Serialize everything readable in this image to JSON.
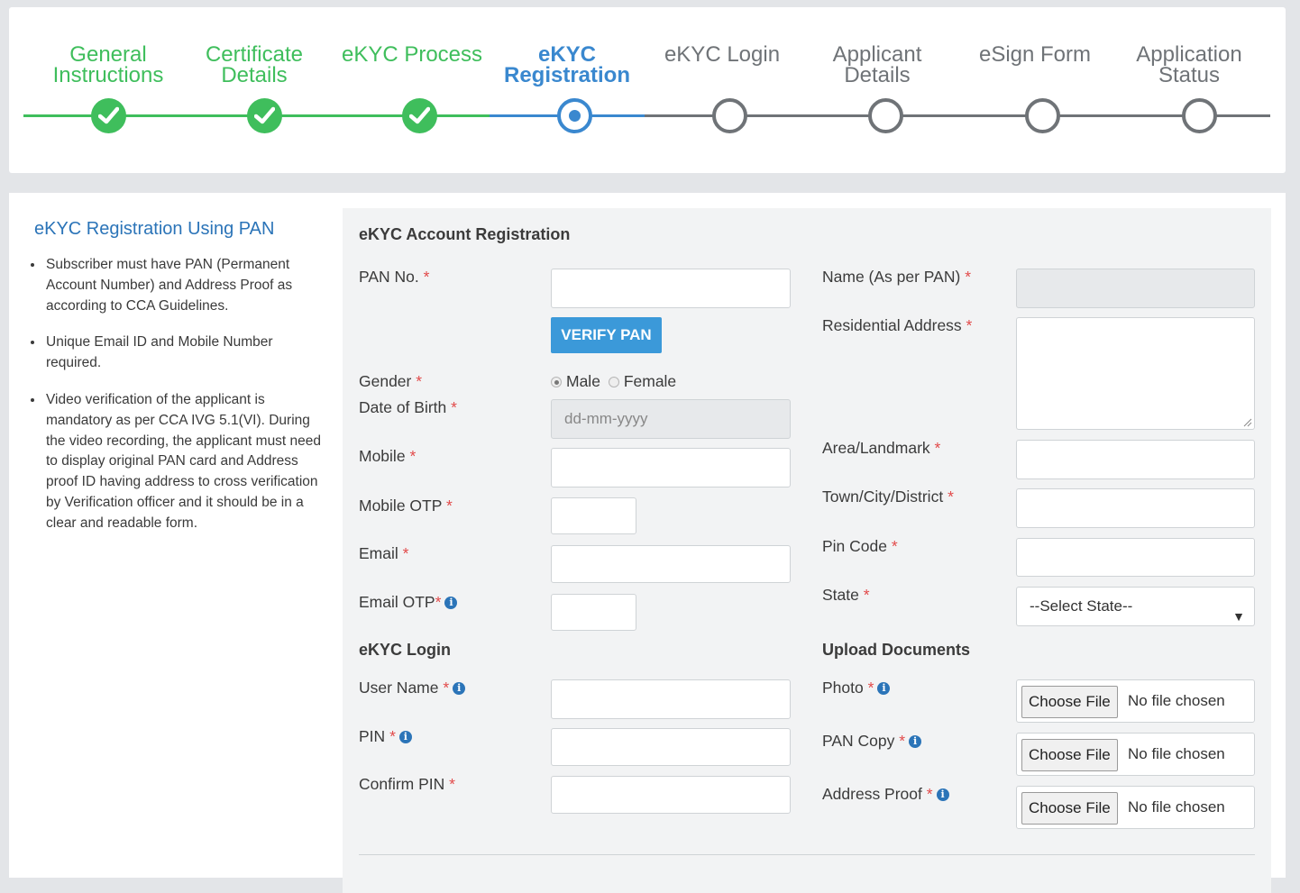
{
  "stepper": {
    "steps": [
      {
        "label": "General Instructions",
        "line1": "General",
        "line2": "Instructions",
        "state": "done"
      },
      {
        "label": "Certificate Details",
        "line1": "Certificate",
        "line2": "Details",
        "state": "done"
      },
      {
        "label": "eKYC Process",
        "line1": "eKYC Process",
        "line2": "",
        "state": "done"
      },
      {
        "label": "eKYC Registration",
        "line1": "eKYC",
        "line2": "Registration",
        "state": "active"
      },
      {
        "label": "eKYC Login",
        "line1": "eKYC Login",
        "line2": "",
        "state": "todo"
      },
      {
        "label": "Applicant Details",
        "line1": "Applicant",
        "line2": "Details",
        "state": "todo"
      },
      {
        "label": "eSign Form",
        "line1": "eSign Form",
        "line2": "",
        "state": "todo"
      },
      {
        "label": "Application Status",
        "line1": "Application",
        "line2": "Status",
        "state": "todo"
      }
    ],
    "colors": {
      "done": "#3fbe5c",
      "active": "#3a88cf",
      "todo": "#6f7377"
    }
  },
  "sidebar": {
    "title": "eKYC Registration Using PAN",
    "bullets": [
      "Subscriber must have PAN (Permanent Account Number) and Address Proof as according to CCA Guidelines.",
      "Unique Email ID and Mobile Number required.",
      "Video verification of the applicant is mandatory as per CCA IVG 5.1(VI). During the video recording, the applicant must need to display original PAN card and Address proof ID having address to cross verification by Verification officer and it should be in a clear and readable form."
    ]
  },
  "form": {
    "section_title": "eKYC Account Registration",
    "required_mark": "*",
    "pan_label": "PAN No.",
    "pan_value": "",
    "verify_button": "VERIFY PAN",
    "gender_label": "Gender",
    "gender_male": "Male",
    "gender_female": "Female",
    "gender_selected": "Male",
    "dob_label": "Date of Birth",
    "dob_placeholder": "dd-mm-yyyy",
    "mobile_label": "Mobile",
    "mobile_otp_label": "Mobile OTP",
    "email_label": "Email",
    "email_otp_label": "Email OTP",
    "name_label": "Name (As per PAN)",
    "address_label": "Residential Address",
    "area_label": "Area/Landmark",
    "town_label": "Town/City/District",
    "pin_code_label": "Pin Code",
    "state_label": "State",
    "state_selected": "--Select State--",
    "login_section": "eKYC Login",
    "username_label": "User Name",
    "pin_label": "PIN",
    "confirm_pin_label": "Confirm PIN",
    "upload_section": "Upload Documents",
    "photo_label": "Photo",
    "pan_copy_label": "PAN Copy",
    "address_proof_label": "Address Proof",
    "choose_file": "Choose File",
    "no_file": "No file chosen",
    "info_glyph": "i"
  }
}
